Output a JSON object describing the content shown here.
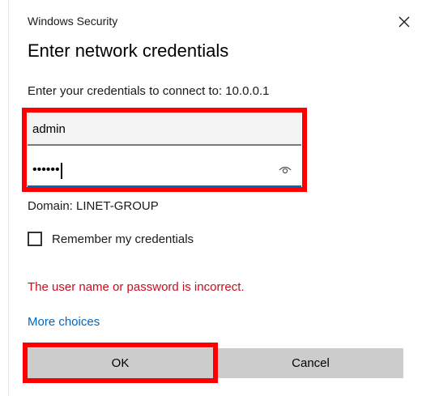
{
  "window": {
    "title": "Windows Security",
    "close_icon": "close-icon"
  },
  "dialog": {
    "heading": "Enter network credentials",
    "connect_text": "Enter your credentials to connect to: 10.0.0.1"
  },
  "form": {
    "username_value": "admin",
    "password_masked": "••••••",
    "password_reveal_icon": "eye-icon",
    "domain_text": "Domain: LINET-GROUP",
    "remember_label": "Remember my credentials",
    "remember_checked": false
  },
  "error_message": "The user name or password is incorrect.",
  "more_choices_label": "More choices",
  "buttons": {
    "ok_label": "OK",
    "cancel_label": "Cancel"
  },
  "colors": {
    "highlight": "#ff0000",
    "error": "#c50f1f",
    "link": "#0067c0",
    "focus_underline": "#0067c0",
    "button_bg": "#cccccc"
  }
}
